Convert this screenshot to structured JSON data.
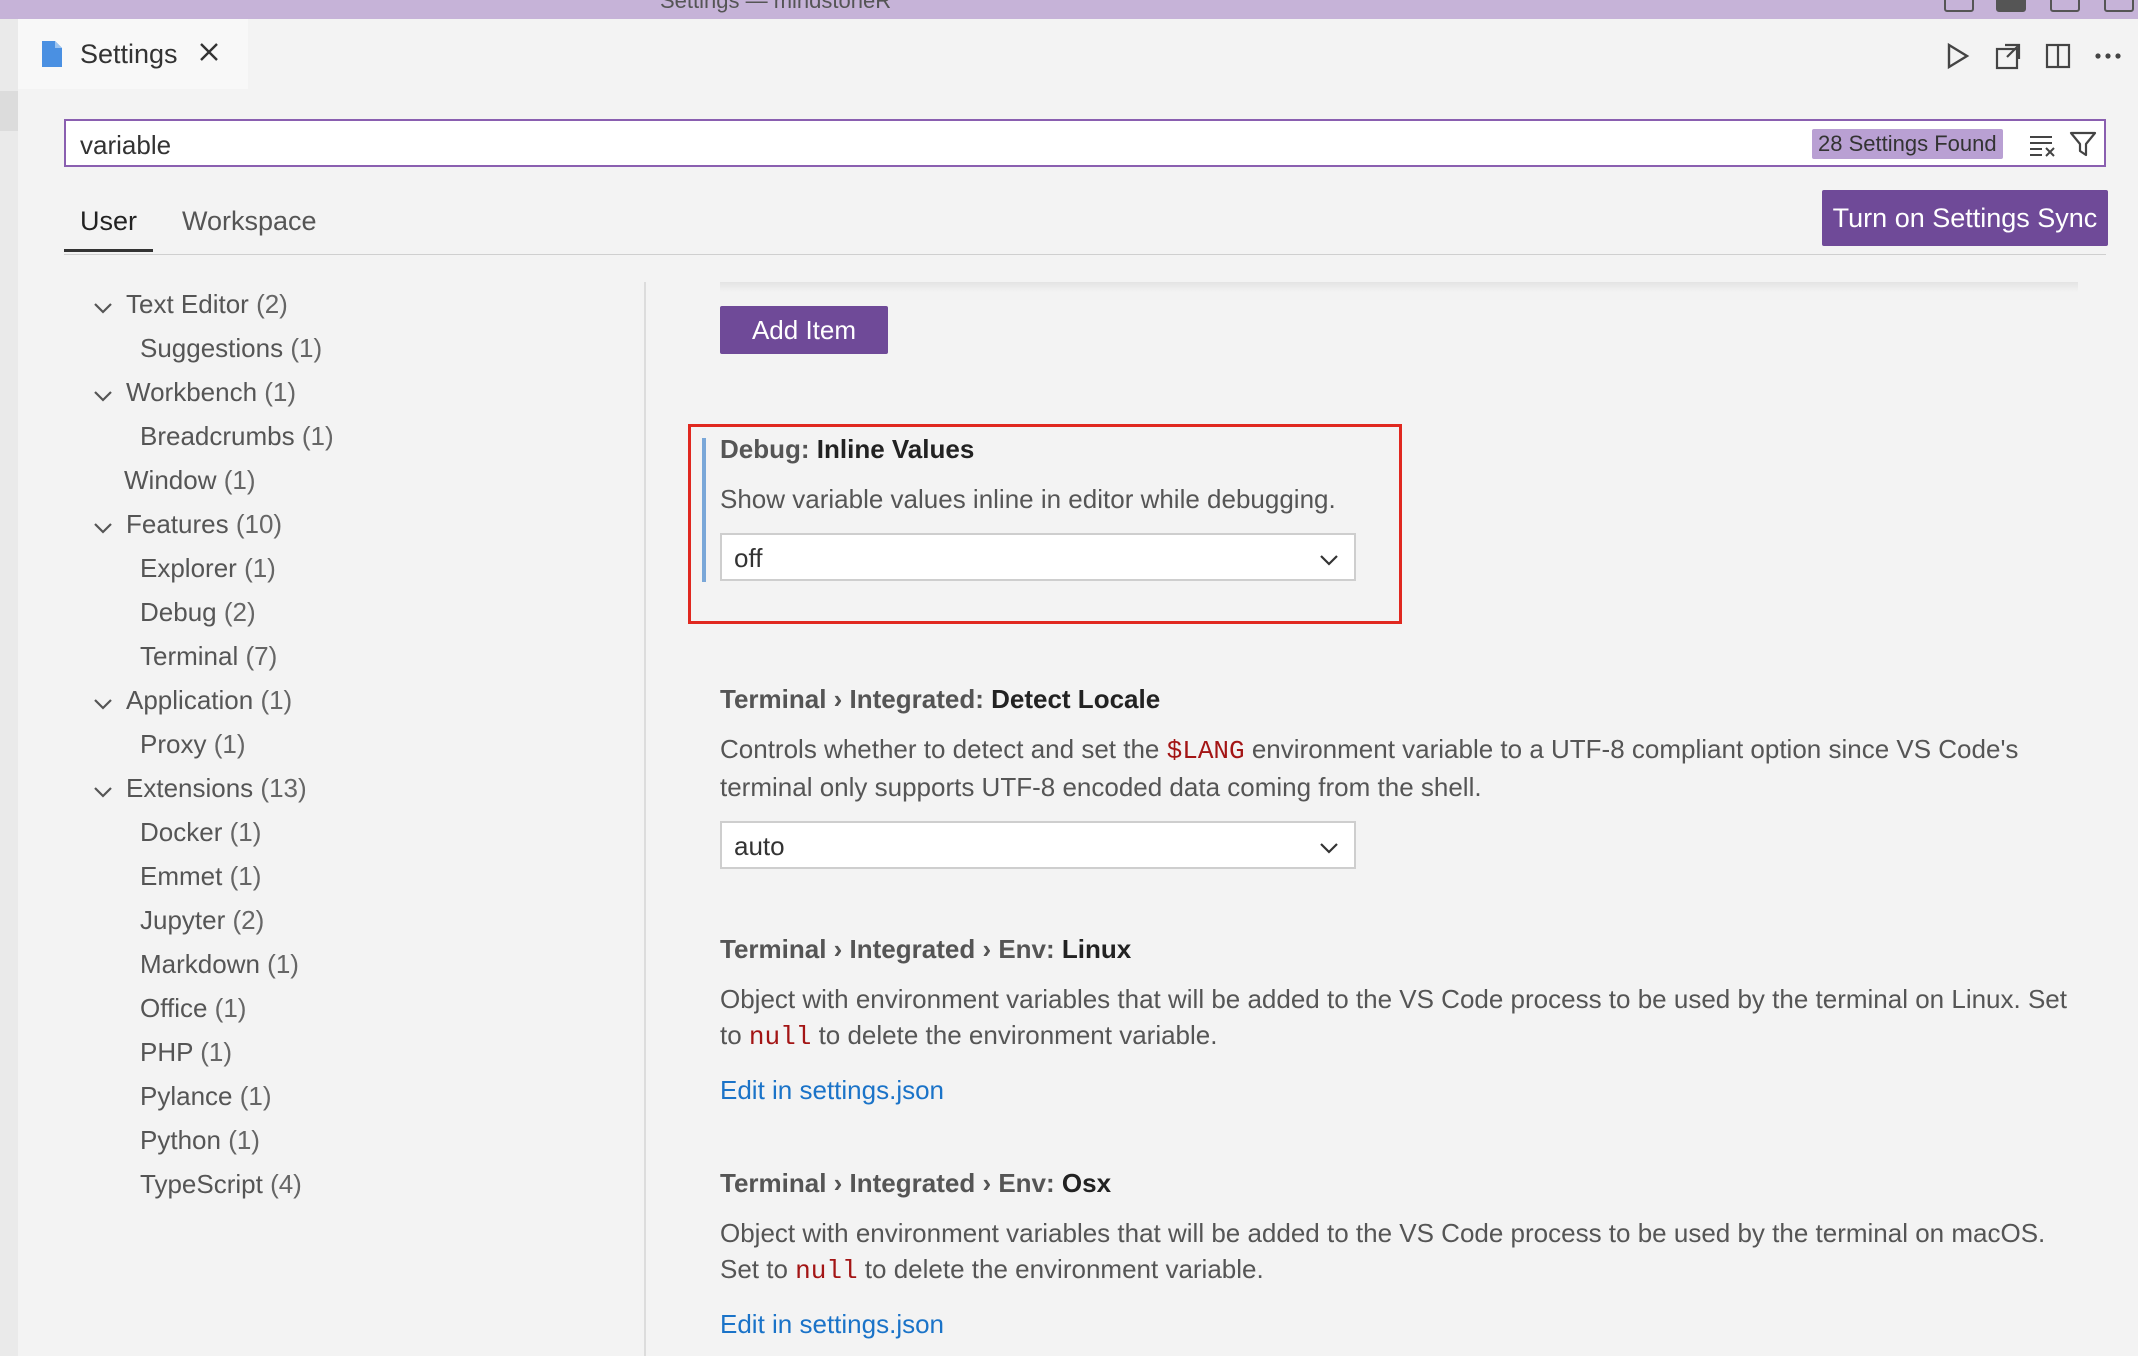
{
  "window": {
    "title_fragment": "Settings — mindstoneR"
  },
  "tab": {
    "label": "Settings"
  },
  "editor_actions": [
    "run-icon",
    "open-json-icon",
    "split-editor-icon",
    "more-actions-icon"
  ],
  "search": {
    "value": "variable",
    "found_badge": "28 Settings Found"
  },
  "scope_tabs": [
    "User",
    "Workspace"
  ],
  "sync_button": "Turn on Settings Sync",
  "toc": [
    {
      "label": "Text Editor",
      "count": "(2)",
      "expandable": true
    },
    {
      "label": "Suggestions",
      "count": "(1)",
      "expandable": false
    },
    {
      "label": "Workbench",
      "count": "(1)",
      "expandable": true
    },
    {
      "label": "Breadcrumbs",
      "count": "(1)",
      "expandable": false
    },
    {
      "label": "Window",
      "count": "(1)",
      "expandable": false
    },
    {
      "label": "Features",
      "count": "(10)",
      "expandable": true
    },
    {
      "label": "Explorer",
      "count": "(1)",
      "expandable": false
    },
    {
      "label": "Debug",
      "count": "(2)",
      "expandable": false
    },
    {
      "label": "Terminal",
      "count": "(7)",
      "expandable": false
    },
    {
      "label": "Application",
      "count": "(1)",
      "expandable": true
    },
    {
      "label": "Proxy",
      "count": "(1)",
      "expandable": false
    },
    {
      "label": "Extensions",
      "count": "(13)",
      "expandable": true
    },
    {
      "label": "Docker",
      "count": "(1)",
      "expandable": false
    },
    {
      "label": "Emmet",
      "count": "(1)",
      "expandable": false
    },
    {
      "label": "Jupyter",
      "count": "(2)",
      "expandable": false
    },
    {
      "label": "Markdown",
      "count": "(1)",
      "expandable": false
    },
    {
      "label": "Office",
      "count": "(1)",
      "expandable": false
    },
    {
      "label": "PHP",
      "count": "(1)",
      "expandable": false
    },
    {
      "label": "Pylance",
      "count": "(1)",
      "expandable": false
    },
    {
      "label": "Python",
      "count": "(1)",
      "expandable": false
    },
    {
      "label": "TypeScript",
      "count": "(4)",
      "expandable": false
    }
  ],
  "add_item_button": "Add Item",
  "settings": [
    {
      "category": "Debug: ",
      "name": "Inline Values",
      "desc_parts": [
        "Show variable values inline in editor while debugging."
      ],
      "dropdown_value": "off"
    },
    {
      "category": "Terminal › Integrated: ",
      "name": "Detect Locale",
      "desc_parts": [
        "Controls whether to detect and set the ",
        "$LANG",
        " environment variable to a UTF-8 compliant option since VS Code's terminal only supports UTF-8 encoded data coming from the shell."
      ],
      "dropdown_value": "auto"
    },
    {
      "category": "Terminal › Integrated › Env: ",
      "name": "Linux",
      "desc_parts": [
        "Object with environment variables that will be added to the VS Code process to be used by the terminal on Linux. Set to ",
        "null",
        " to delete the environment variable."
      ],
      "link": "Edit in settings.json"
    },
    {
      "category": "Terminal › Integrated › Env: ",
      "name": "Osx",
      "desc_parts": [
        "Object with environment variables that will be added to the VS Code process to be used by the terminal on macOS. Set to ",
        "null",
        " to delete the environment variable."
      ],
      "link": "Edit in settings.json"
    }
  ],
  "colors": {
    "accent": "#6f4a98",
    "titlebar": "#c6b3d8",
    "link": "#1a73c8",
    "code": "#a31515",
    "highlight": "#e0281f"
  }
}
